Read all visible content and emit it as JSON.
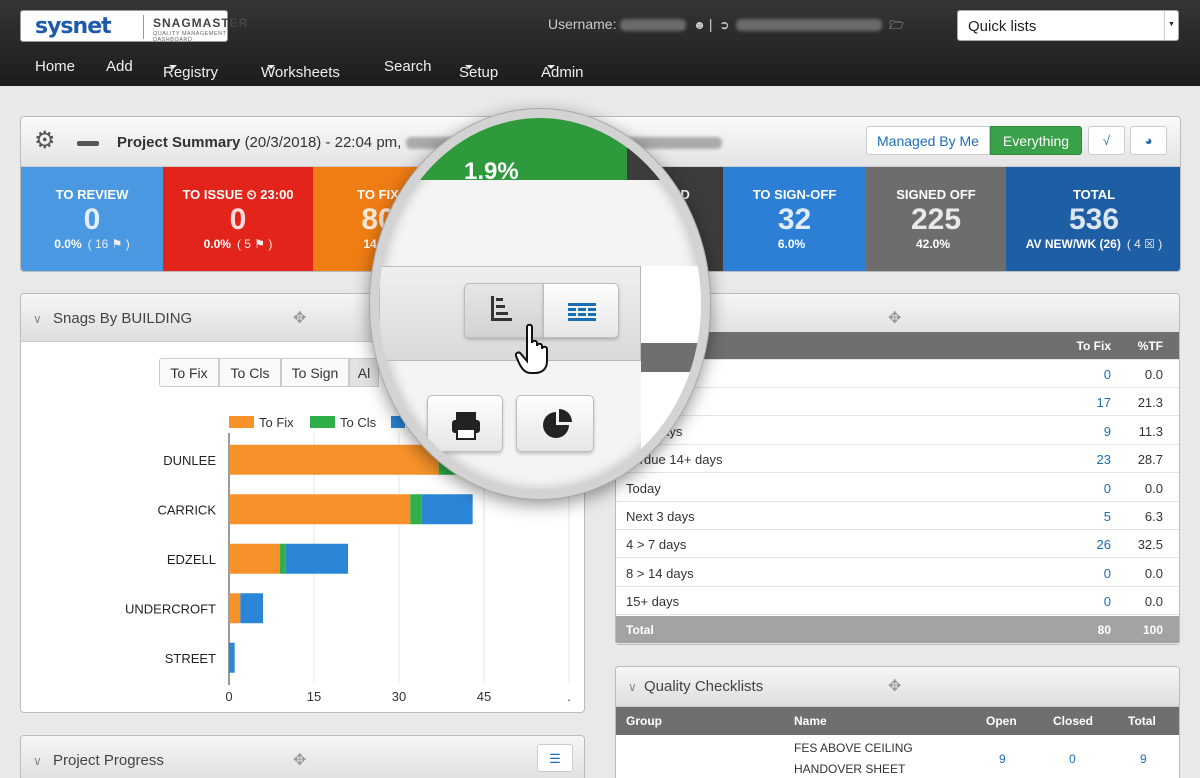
{
  "header": {
    "logo_text": "sysnet",
    "logo_product": "SNAGMASTER",
    "logo_tagline": "QUALITY MANAGEMENT DASHBOARD",
    "username_label": "Username:",
    "quick_lists": "Quick lists"
  },
  "nav": {
    "items": [
      {
        "label": "Home"
      },
      {
        "label": "Add"
      },
      {
        "label": "Registry"
      },
      {
        "label": "Worksheets"
      },
      {
        "label": "Search"
      },
      {
        "label": "Setup"
      },
      {
        "label": "Admin"
      }
    ]
  },
  "summary": {
    "title": "Project Summary",
    "date": "(20/3/2018) - 22:04 pm,",
    "btn_mine": "Managed By Me",
    "btn_everything": "Everything",
    "tiles": [
      {
        "label": "TO REVIEW",
        "value": "0",
        "pct": "0.0%",
        "extra": "( 16 ⚑ )",
        "color": "#4a97e2"
      },
      {
        "label": "TO ISSUE ⏲ 23:00",
        "value": "0",
        "pct": "0.0%",
        "extra": "( 5 ⚑ )",
        "color": "#e3241b"
      },
      {
        "label": "TO FIX",
        "value": "80",
        "pct": "14.9",
        "extra": "",
        "color": "#f07d14"
      },
      {
        "label": "",
        "value": "1.9%",
        "pct": "",
        "extra": "",
        "color": "#2f9a3c"
      },
      {
        "label": "SED",
        "value": "",
        "pct": "",
        "extra": "",
        "color": "#3c3c3c"
      },
      {
        "label": "TO SIGN-OFF",
        "value": "32",
        "pct": "6.0%",
        "extra": "",
        "color": "#2c7fd4"
      },
      {
        "label": "SIGNED OFF",
        "value": "225",
        "pct": "42.0%",
        "extra": "",
        "color": "#6d6d6d"
      },
      {
        "label": "TOTAL",
        "value": "536",
        "pct": "AV NEW/WK (26)",
        "extra": "( 4 ☒ )",
        "color": "#1e5ea5"
      }
    ]
  },
  "snags_panel": {
    "title": "Snags By BUILDING",
    "tabs": [
      "To Fix",
      "To Cls",
      "To Sign",
      "Al"
    ],
    "legend": [
      {
        "name": "To Fix",
        "color": "#f7922a"
      },
      {
        "name": "To Cls",
        "color": "#2fae4a"
      },
      {
        "name": "",
        "color": "#2b86d8"
      }
    ]
  },
  "chart_data": {
    "type": "bar",
    "orientation": "horizontal",
    "stacked": true,
    "categories": [
      "DUNLEE",
      "CARRICK",
      "EDZELL",
      "UNDERCROFT",
      "STREET"
    ],
    "series": [
      {
        "name": "To Fix",
        "values": [
          37,
          32,
          9,
          2,
          0
        ]
      },
      {
        "name": "To Cls",
        "values": [
          3,
          2,
          1,
          0,
          0
        ]
      },
      {
        "name": "",
        "values": [
          5,
          9,
          11,
          4,
          1
        ]
      }
    ],
    "xticks": [
      "0",
      "15",
      "30",
      "45",
      "."
    ],
    "xlim": [
      0,
      60
    ],
    "grid": true,
    "colors": [
      "#f7922a",
      "#2fae4a",
      "#2b86d8"
    ]
  },
  "due_panel": {
    "head_tofix": "To Fix",
    "head_pct": "%TF",
    "rows": [
      {
        "label": "s",
        "tofix": "0",
        "pct": "0.0"
      },
      {
        "label": "days",
        "tofix": "17",
        "pct": "21.3"
      },
      {
        "label": "e 14 days",
        "tofix": "9",
        "pct": "11.3"
      },
      {
        "label": "verdue 14+ days",
        "tofix": "23",
        "pct": "28.7"
      },
      {
        "label": "Today",
        "tofix": "0",
        "pct": "0.0"
      },
      {
        "label": "Next 3 days",
        "tofix": "5",
        "pct": "6.3"
      },
      {
        "label": "4 > 7 days",
        "tofix": "26",
        "pct": "32.5"
      },
      {
        "label": "8 > 14 days",
        "tofix": "0",
        "pct": "0.0"
      },
      {
        "label": "15+ days",
        "tofix": "0",
        "pct": "0.0"
      }
    ],
    "total_label": "Total",
    "total_tofix": "80",
    "total_pct": "100"
  },
  "qc_panel": {
    "title": "Quality Checklists",
    "cols": [
      "Group",
      "Name",
      "Open",
      "Closed",
      "Total"
    ],
    "row": {
      "name1": "FES ABOVE CEILING",
      "name2": "HANDOVER SHEET",
      "open": "9",
      "closed": "0",
      "total": "9"
    }
  },
  "progress_panel": {
    "title": "Project Progress"
  }
}
